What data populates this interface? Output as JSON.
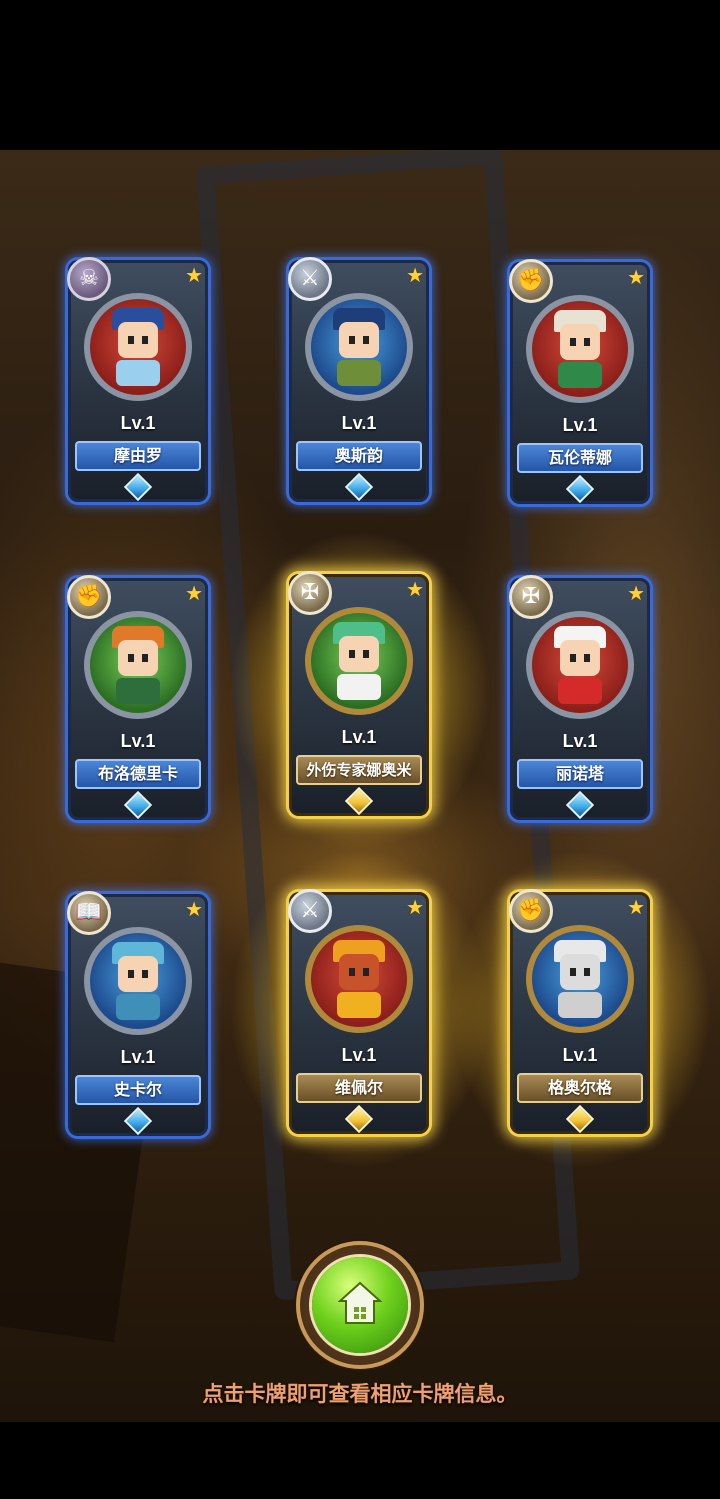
{
  "hint_text": "点击卡牌即可查看相应卡牌信息。",
  "cards": [
    {
      "name": "摩由罗",
      "level": "Lv.1",
      "emblem": "skull-icon"
    },
    {
      "name": "奥斯韵",
      "level": "Lv.1",
      "emblem": "crossed-swords-icon"
    },
    {
      "name": "瓦伦蒂娜",
      "level": "Lv.1",
      "emblem": "fist-icon"
    },
    {
      "name": "布洛德里卡",
      "level": "Lv.1",
      "emblem": "fist-icon"
    },
    {
      "name": "外伤专家娜奥米",
      "level": "Lv.1",
      "emblem": "winged-cross-icon"
    },
    {
      "name": "丽诺塔",
      "level": "Lv.1",
      "emblem": "winged-cross-icon"
    },
    {
      "name": "史卡尔",
      "level": "Lv.1",
      "emblem": "book-icon"
    },
    {
      "name": "维佩尔",
      "level": "Lv.1",
      "emblem": "crossed-swords-icon"
    },
    {
      "name": "格奥尔格",
      "level": "Lv.1",
      "emblem": "fist-icon"
    }
  ]
}
